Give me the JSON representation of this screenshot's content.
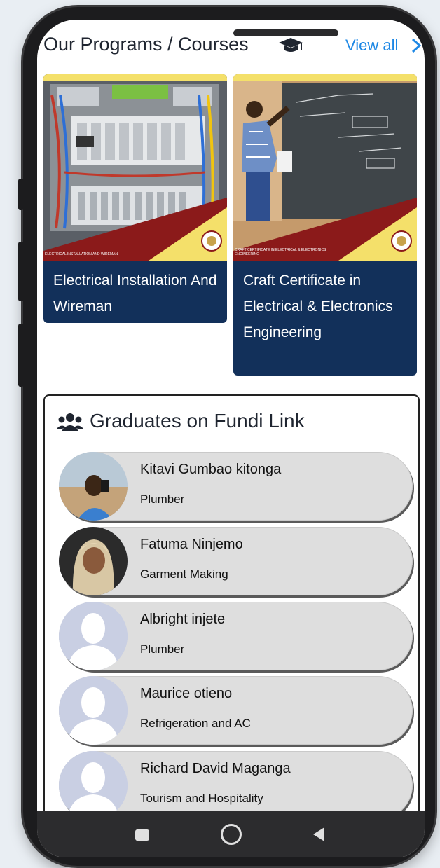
{
  "header": {
    "title": "Our Programs / Courses",
    "view_all_label": "View all"
  },
  "courses": [
    {
      "title": "Electrical Installation And Wireman",
      "banner_text": "ELECTRICAL INSTALLATION AND WIREMAN"
    },
    {
      "title": "Craft Certificate in Electrical & Electronics Engineering",
      "banner_text": "CRAFT CERTIFICATE IN ELECTRICAL & ELECTRONICS ENGINEERING"
    }
  ],
  "graduates": {
    "title": "Graduates on Fundi Link",
    "items": [
      {
        "name": "Kitavi Gumbao kitonga",
        "trade": "Plumber",
        "avatar": "photo"
      },
      {
        "name": "Fatuma Ninjemo",
        "trade": "Garment Making",
        "avatar": "photo"
      },
      {
        "name": "Albright injete",
        "trade": "Plumber",
        "avatar": "placeholder"
      },
      {
        "name": "Maurice otieno",
        "trade": "Refrigeration and AC",
        "avatar": "placeholder"
      },
      {
        "name": "Richard David Maganga",
        "trade": "Tourism and Hospitality",
        "avatar": "placeholder"
      }
    ]
  },
  "colors": {
    "card_bg": "#12305a",
    "link": "#1e88e5",
    "row_bg": "#dedede",
    "banner_yellow": "#f4e06a",
    "banner_red": "#8b1a1a"
  }
}
